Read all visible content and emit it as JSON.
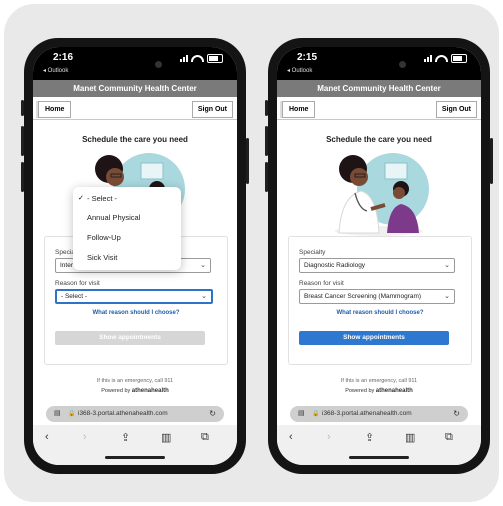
{
  "status": {
    "time_left": "2:16",
    "time_right": "2:15",
    "back_app": "◂ Outlook"
  },
  "header": {
    "title": "Manet Community Health Center",
    "home_label": "Home",
    "signout_label": "Sign Out"
  },
  "page": {
    "heading": "Schedule the care you need"
  },
  "left_form": {
    "specialty_label": "Specialty",
    "specialty_value": "Interventional Radiology",
    "reason_label": "Reason for visit",
    "reason_value": "- Select -",
    "help_link": "What reason should I choose?",
    "show_button": "Show appointments"
  },
  "dropdown": {
    "items": [
      {
        "label": "- Select -",
        "checked": true
      },
      {
        "label": "Annual Physical"
      },
      {
        "label": "Follow-Up"
      },
      {
        "label": "Sick Visit"
      }
    ]
  },
  "right_form": {
    "specialty_label": "Specialty",
    "specialty_value": "Diagnostic Radiology",
    "reason_label": "Reason for visit",
    "reason_value": "Breast Cancer Screening (Mammogram)",
    "help_link": "What reason should I choose?",
    "show_button": "Show appointments"
  },
  "footer": {
    "emergency": "If this is an emergency, call 911",
    "powered_by": "Powered by",
    "brand": "athenahealth"
  },
  "browser": {
    "url": "i368-3.portal.athenahealth.com"
  },
  "colors": {
    "accent": "#2f78cf",
    "title_bar": "#7a7a7a",
    "link": "#1f5ea8"
  }
}
